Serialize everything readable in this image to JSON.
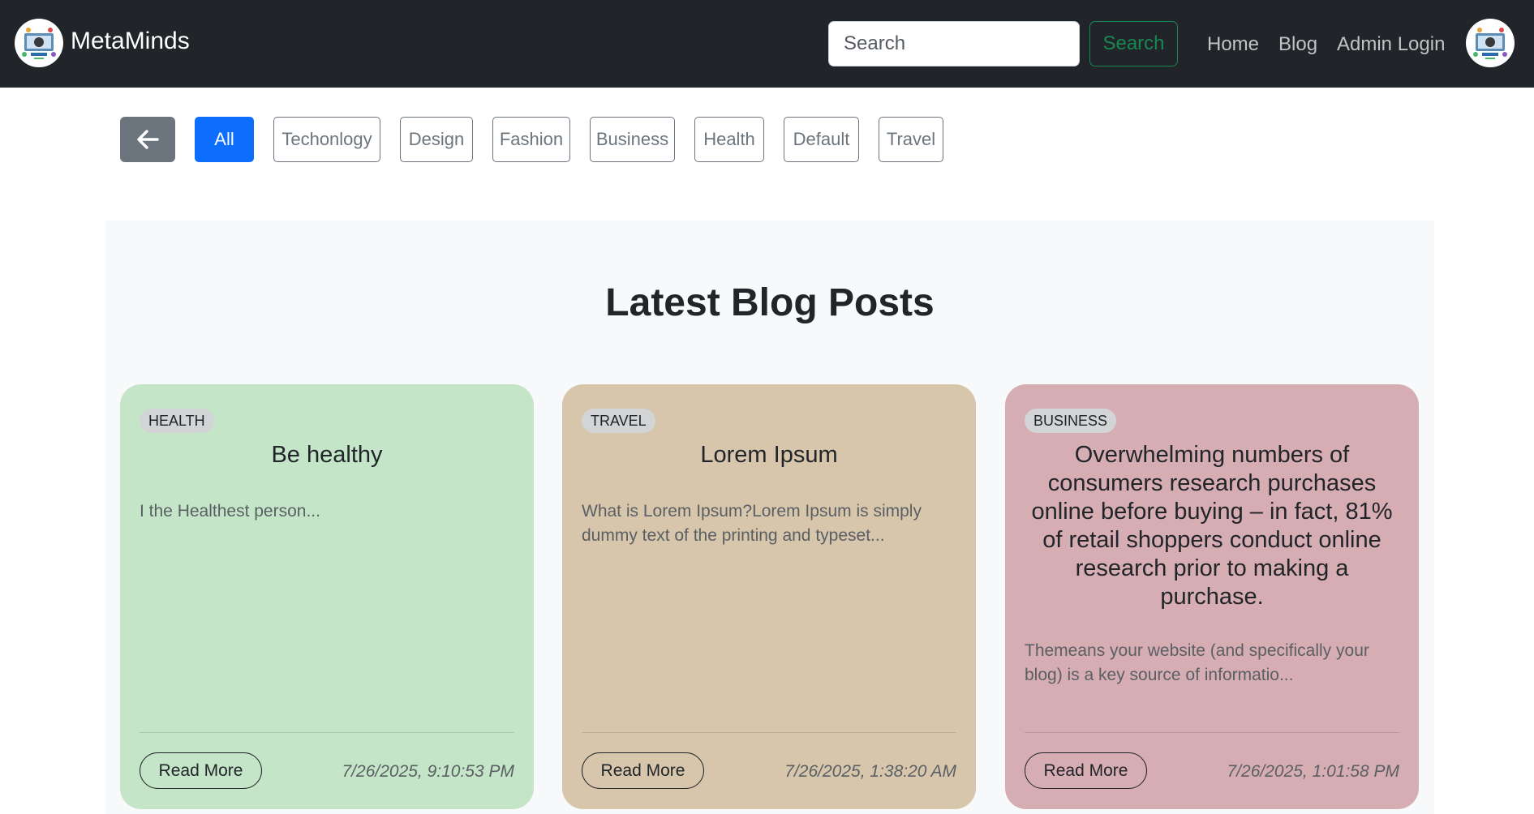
{
  "navbar": {
    "brand": "MetaMinds",
    "search_placeholder": "Search",
    "search_button": "Search",
    "links": [
      "Home",
      "Blog",
      "Admin Login"
    ]
  },
  "filters": {
    "active": "All",
    "categories": [
      "All",
      "Techonlogy",
      "Design",
      "Fashion",
      "Business",
      "Health",
      "Default",
      "Travel"
    ]
  },
  "section": {
    "title": "Latest Blog Posts"
  },
  "posts": [
    {
      "category": "HEALTH",
      "title": "Be healthy",
      "excerpt": "I the Healthest person...",
      "button": "Read More",
      "date": "7/26/2025, 9:10:53 PM",
      "color": "#c5e5c8"
    },
    {
      "category": "TRAVEL",
      "title": "Lorem Ipsum",
      "excerpt": "What is Lorem Ipsum?Lorem Ipsum is simply dummy text of the printing and typeset...",
      "button": "Read More",
      "date": "7/26/2025, 1:38:20 AM",
      "color": "#d7c6ab"
    },
    {
      "category": "BUSINESS",
      "title": "Overwhelming numbers of consumers research purchases online before buying – in fact, 81% of retail shoppers conduct online research prior to making a purchase.",
      "excerpt": "Themeans your website (and specifically your blog) is a key source of informatio...",
      "button": "Read More",
      "date": "7/26/2025, 1:01:58 PM",
      "color": "#d7adb4"
    }
  ],
  "colors": {
    "navbar_bg": "#212529",
    "primary": "#0d6efd",
    "success": "#198754",
    "secondary": "#6c757d"
  },
  "icons": {
    "back": "arrow-left-icon",
    "logo": "brand-logo-icon",
    "avatar": "user-avatar-icon"
  }
}
